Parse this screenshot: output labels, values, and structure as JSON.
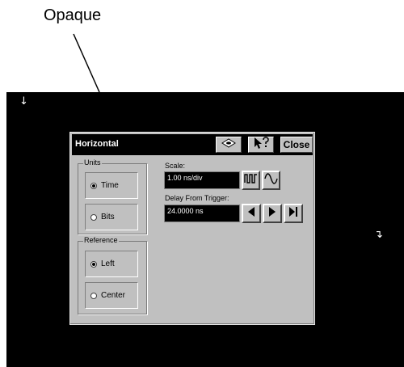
{
  "callout": {
    "label": "Opaque"
  },
  "screen": {
    "marker_left": "↓",
    "marker_right": "↴"
  },
  "dialog": {
    "title": "Horizontal",
    "toolbar": {
      "save_icon": "disk-icon",
      "help_icon": "pointer-help-icon",
      "close_label": "Close"
    },
    "units": {
      "legend": "Units",
      "options": [
        {
          "label": "Time",
          "selected": true
        },
        {
          "label": "Bits",
          "selected": false
        }
      ]
    },
    "reference": {
      "legend": "Reference",
      "options": [
        {
          "label": "Left",
          "selected": true
        },
        {
          "label": "Center",
          "selected": false
        }
      ]
    },
    "scale": {
      "label": "Scale:",
      "value": "1.00 ns/div",
      "buttons": [
        "square-wave-icon",
        "sine-wave-icon"
      ]
    },
    "delay": {
      "label": "Delay From Trigger:",
      "value": "24.0000 ns",
      "buttons": [
        "arrow-left-icon",
        "arrow-right-icon",
        "arrow-right-end-icon"
      ]
    }
  }
}
